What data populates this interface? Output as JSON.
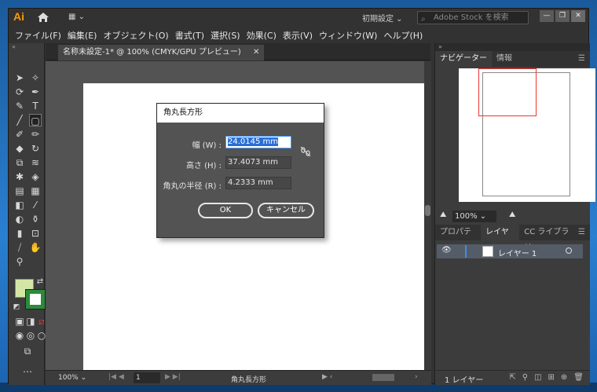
{
  "app": {
    "logo": "Ai",
    "workspace": "初期設定",
    "stock_search_placeholder": "Adobe Stock を検索",
    "window_buttons": [
      "—",
      "❐",
      "✕"
    ]
  },
  "menu": [
    "ファイル(F)",
    "編集(E)",
    "オブジェクト(O)",
    "書式(T)",
    "選択(S)",
    "効果(C)",
    "表示(V)",
    "ウィンドウ(W)",
    "ヘルプ(H)"
  ],
  "document": {
    "tab_title": "名称未設定-1* @ 100% (CMYK/GPU プレビュー)",
    "tab_close": "✕"
  },
  "statusbar": {
    "zoom": "100%",
    "page": "1",
    "tool_name": "角丸長方形"
  },
  "dialog": {
    "title": "角丸長方形",
    "width_label": "幅 (W) :",
    "width_value": "24.0145 mm",
    "height_label": "高さ (H) :",
    "height_value": "37.4073 mm",
    "radius_label": "角丸の半径 (R) :",
    "radius_value": "4.2333 mm",
    "ok_label": "OK",
    "cancel_label": "キャンセル"
  },
  "navigator": {
    "tabs": [
      "ナビゲーター",
      "情報"
    ],
    "zoom": "100%"
  },
  "layers": {
    "tabs": [
      "プロパティ",
      "レイヤー",
      "CC ライブラリ"
    ],
    "items": [
      {
        "name": "レイヤー 1"
      }
    ],
    "count": "1 レイヤー"
  },
  "colors": {
    "fill": "#d4e6a6",
    "stroke": "#2d8a3c",
    "accent": "#ff9a00"
  }
}
